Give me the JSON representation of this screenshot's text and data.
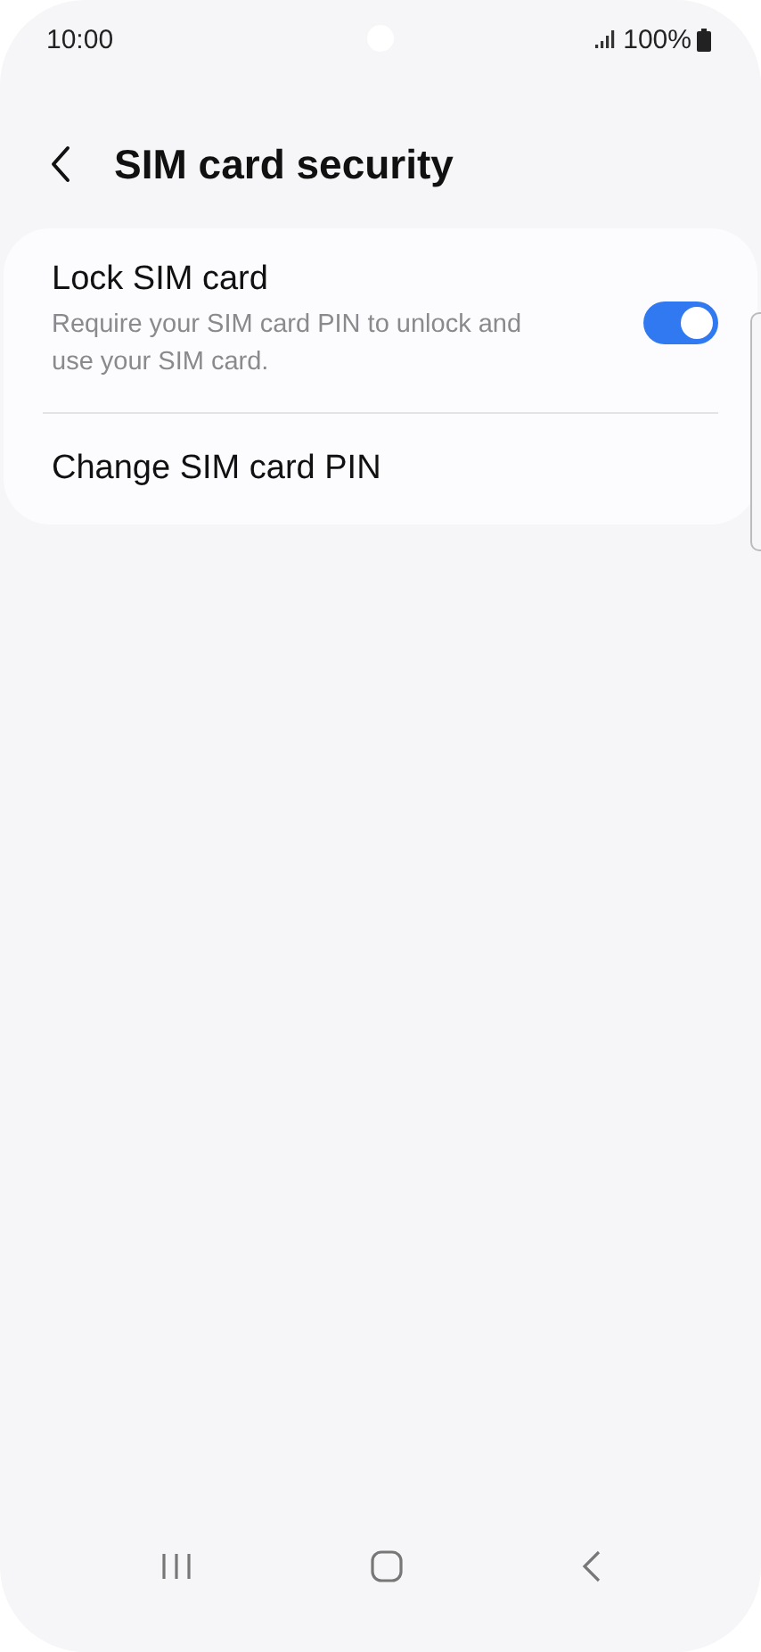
{
  "status_bar": {
    "time": "10:00",
    "battery": "100%"
  },
  "header": {
    "title": "SIM card security"
  },
  "settings": [
    {
      "kind": "switch",
      "title": "Lock SIM card",
      "summary": "Require your SIM card PIN to unlock and use your SIM card.",
      "on": true
    },
    {
      "kind": "link",
      "title": "Change SIM card PIN"
    }
  ]
}
